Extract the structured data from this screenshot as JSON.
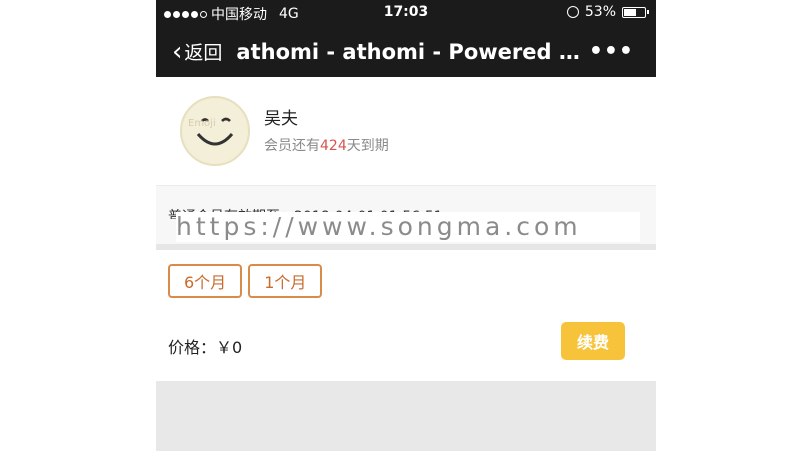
{
  "status_bar": {
    "carrier": "中国移动",
    "network": "4G",
    "time": "17:03",
    "battery": "53%"
  },
  "navbar": {
    "back_label": "返回",
    "title": "athomi - athomi - Powered by W...",
    "more_label": "•••"
  },
  "profile": {
    "name": "吴夫",
    "expire_prefix": "会员还有",
    "expire_days": "424",
    "expire_suffix": "天到期"
  },
  "expiry": {
    "text": "普通会员有效期至：2018-04-01 01:56:51",
    "watermark": "https://www.songma.com"
  },
  "options": [
    "6个月",
    "1个月"
  ],
  "price": {
    "label": "价格：￥0"
  },
  "renew_label": "续费",
  "colors": {
    "header_bg": "#1b1b1b",
    "accent_orange": "#d98b4a",
    "renew_yellow": "#f6c33b",
    "days_red": "#d9534f"
  }
}
